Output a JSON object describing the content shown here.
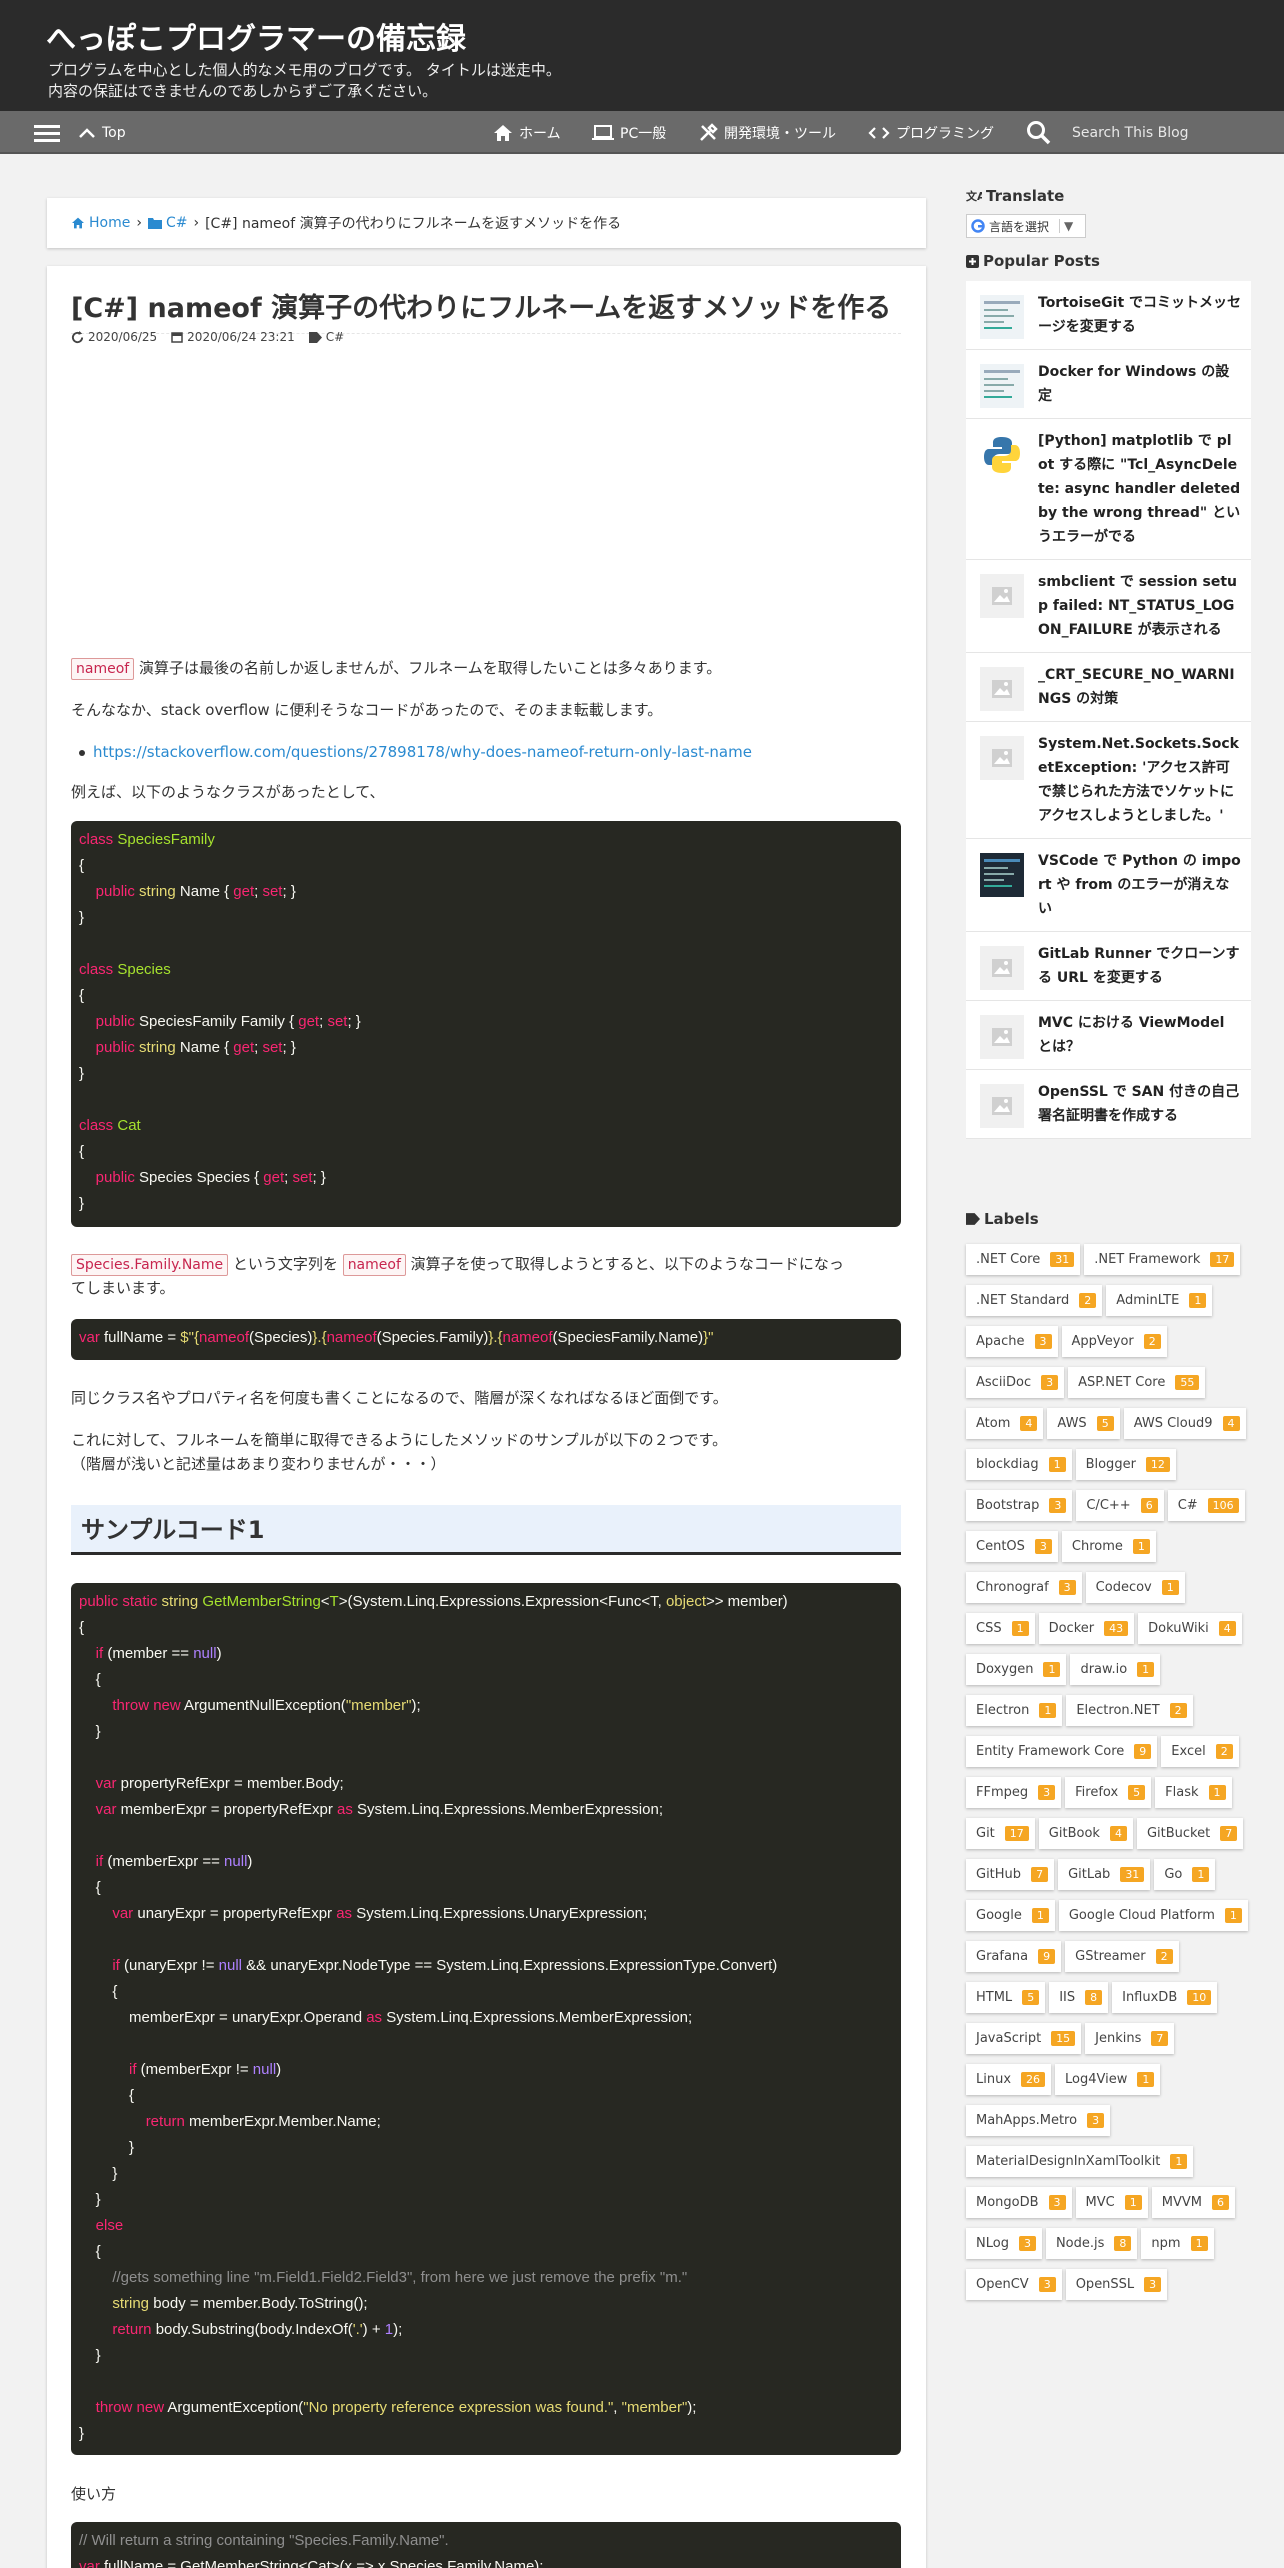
{
  "header": {
    "title": "へっぽこプログラマーの備忘録",
    "desc_line1": "プログラムを中心とした個人的なメモ用のブログです。 タイトルは迷走中。",
    "desc_line2": "内容の保証はできませんのであしからずご了承ください。"
  },
  "nav": {
    "top": "Top",
    "home": "ホーム",
    "pc": "PC一般",
    "tools": "開発環境・ツール",
    "programming": "プログラミング",
    "search_placeholder": "Search This Blog"
  },
  "breadcrumb": {
    "home": "Home",
    "category": "C#",
    "current": "[C#] nameof 演算子の代わりにフルネームを返すメソッドを作る"
  },
  "post": {
    "title": "[C#] nameof 演算子の代わりにフルネームを返すメソッドを作る",
    "updated": "2020/06/25",
    "published": "2020/06/24 23:21",
    "label": "C#",
    "p1_code": "nameof",
    "p1_text": " 演算子は最後の名前しか返しませんが、フルネームを取得したいことは多々あります。",
    "p2": "そんななか、stack overflow に便利そうなコードがあったので、そのまま転載します。",
    "link": "https://stackoverflow.com/questions/27898178/why-does-nameof-return-only-last-name",
    "p3": "例えば、以下のようなクラスがあったとして、",
    "p4_code1": "Species.Family.Name",
    "p4_text1": " という文字列を ",
    "p4_code2": "nameof",
    "p4_text2": " 演算子を使って取得しようとすると、以下のようなコードになっ",
    "p4_text3": "てしまいます。",
    "p5": "同じクラス名やプロパティ名を何度も書くことになるので、階層が深くなればなるほど面倒です。",
    "p6_line1": "これに対して、フルネームを簡単に取得できるようにしたメソッドのサンプルが以下の２つです。",
    "p6_line2": "（階層が浅いと記述量はあまり変わりませんが・・・）",
    "h2": "サンプルコード1",
    "p7": "使い方",
    "usage_comment": "// Will return a string containing \"Species.Family.Name\"."
  },
  "sidebar": {
    "translate_title": "Translate",
    "translate_select": "言語を選択",
    "popular_title": "Popular Posts",
    "popular": [
      {
        "title": "TortoiseGit でコミットメッセージを変更する",
        "icon": "screenshot-thumb"
      },
      {
        "title": "Docker for Windows の設定",
        "icon": "screenshot-thumb"
      },
      {
        "title": "[Python] matplotlib で plot する際に \"Tcl_AsyncDelete: async handler deleted by the wrong thread\" というエラーがでる",
        "icon": "python-logo"
      },
      {
        "title": "smbclient で session setup failed: NT_STATUS_LOGON_FAILURE が表示される",
        "icon": "no-image"
      },
      {
        "title": "_CRT_SECURE_NO_WARNINGS の対策",
        "icon": "no-image"
      },
      {
        "title": "System.Net.Sockets.SocketException: 'アクセス許可で禁じられた方法でソケットにアクセスしようとしました。'",
        "icon": "no-image"
      },
      {
        "title": "VSCode で Python の import や from のエラーが消えない",
        "icon": "screenshot-thumb"
      },
      {
        "title": "GitLab Runner でクローンする URL を変更する",
        "icon": "no-image"
      },
      {
        "title": "MVC における ViewModel とは？",
        "icon": "no-image"
      },
      {
        "title": "OpenSSL で SAN 付きの自己署名証明書を作成する",
        "icon": "no-image"
      }
    ],
    "labels_title": "Labels",
    "labels": [
      {
        "name": ".NET Core",
        "count": "31"
      },
      {
        "name": ".NET Framework",
        "count": "17"
      },
      {
        "name": ".NET Standard",
        "count": "2"
      },
      {
        "name": "AdminLTE",
        "count": "1"
      },
      {
        "name": "Apache",
        "count": "3"
      },
      {
        "name": "AppVeyor",
        "count": "2"
      },
      {
        "name": "AsciiDoc",
        "count": "3"
      },
      {
        "name": "ASP.NET Core",
        "count": "55"
      },
      {
        "name": "Atom",
        "count": "4"
      },
      {
        "name": "AWS",
        "count": "5"
      },
      {
        "name": "AWS Cloud9",
        "count": "4"
      },
      {
        "name": "blockdiag",
        "count": "1"
      },
      {
        "name": "Blogger",
        "count": "12"
      },
      {
        "name": "Bootstrap",
        "count": "3"
      },
      {
        "name": "C/C++",
        "count": "6"
      },
      {
        "name": "C#",
        "count": "106"
      },
      {
        "name": "CentOS",
        "count": "3"
      },
      {
        "name": "Chrome",
        "count": "1"
      },
      {
        "name": "Chronograf",
        "count": "3"
      },
      {
        "name": "Codecov",
        "count": "1"
      },
      {
        "name": "CSS",
        "count": "1"
      },
      {
        "name": "Docker",
        "count": "43"
      },
      {
        "name": "DokuWiki",
        "count": "4"
      },
      {
        "name": "Doxygen",
        "count": "1"
      },
      {
        "name": "draw.io",
        "count": "1"
      },
      {
        "name": "Electron",
        "count": "1"
      },
      {
        "name": "Electron.NET",
        "count": "2"
      },
      {
        "name": "Entity Framework Core",
        "count": "9"
      },
      {
        "name": "Excel",
        "count": "2"
      },
      {
        "name": "FFmpeg",
        "count": "3"
      },
      {
        "name": "Firefox",
        "count": "5"
      },
      {
        "name": "Flask",
        "count": "1"
      },
      {
        "name": "Git",
        "count": "17"
      },
      {
        "name": "GitBook",
        "count": "4"
      },
      {
        "name": "GitBucket",
        "count": "7"
      },
      {
        "name": "GitHub",
        "count": "7"
      },
      {
        "name": "GitLab",
        "count": "31"
      },
      {
        "name": "Go",
        "count": "1"
      },
      {
        "name": "Google",
        "count": "1"
      },
      {
        "name": "Google Cloud Platform",
        "count": "1"
      },
      {
        "name": "Grafana",
        "count": "9"
      },
      {
        "name": "GStreamer",
        "count": "2"
      },
      {
        "name": "HTML",
        "count": "5"
      },
      {
        "name": "IIS",
        "count": "8"
      },
      {
        "name": "InfluxDB",
        "count": "10"
      },
      {
        "name": "JavaScript",
        "count": "15"
      },
      {
        "name": "Jenkins",
        "count": "7"
      },
      {
        "name": "Linux",
        "count": "26"
      },
      {
        "name": "Log4View",
        "count": "1"
      },
      {
        "name": "MahApps.Metro",
        "count": "3"
      },
      {
        "name": "MaterialDesignInXamlToolkit",
        "count": "1"
      },
      {
        "name": "MongoDB",
        "count": "3"
      },
      {
        "name": "MVC",
        "count": "1"
      },
      {
        "name": "MVVM",
        "count": "6"
      },
      {
        "name": "NLog",
        "count": "3"
      },
      {
        "name": "Node.js",
        "count": "8"
      },
      {
        "name": "npm",
        "count": "1"
      },
      {
        "name": "OpenCV",
        "count": "3"
      },
      {
        "name": "OpenSSL",
        "count": "3"
      }
    ]
  }
}
